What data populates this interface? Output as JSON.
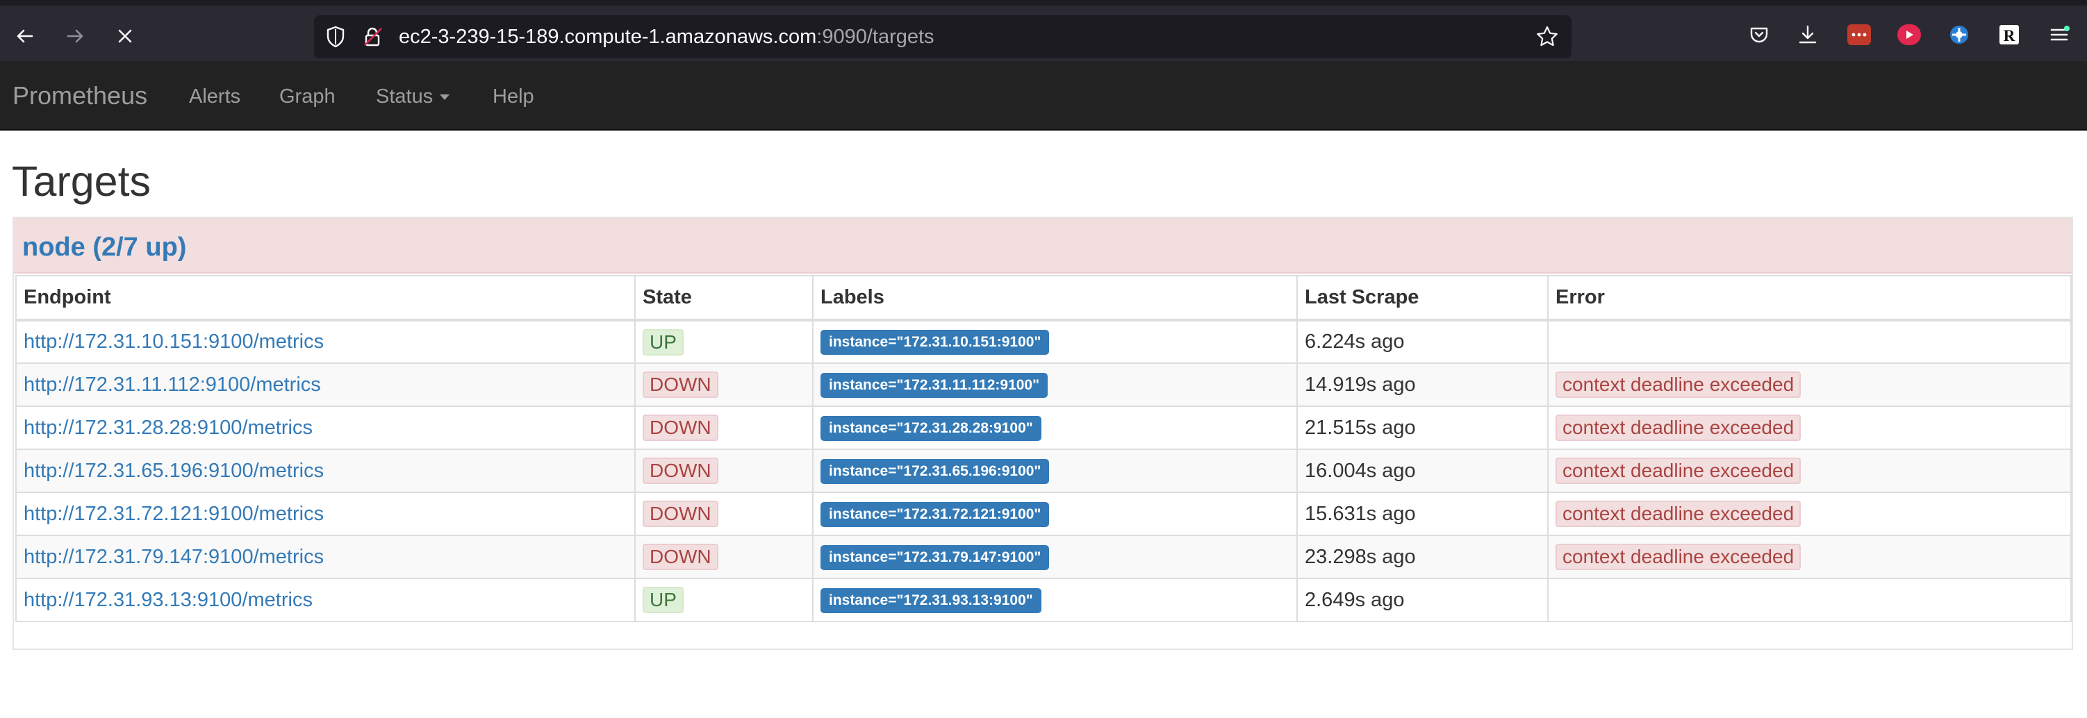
{
  "browser": {
    "url_host": "ec2-3-239-15-189.compute-1.amazonaws.com",
    "url_rest": ":9090/targets",
    "icons": [
      "back-icon",
      "forward-icon",
      "stop-icon",
      "shield-icon",
      "lock-icon",
      "bookmark-star-icon",
      "pocket-icon",
      "download-icon",
      "extension-icon",
      "extension-icon",
      "extension-icon",
      "readwise-icon",
      "menu-icon"
    ]
  },
  "navbar": {
    "brand": "Prometheus",
    "links": [
      "Alerts",
      "Graph",
      "Status",
      "Help"
    ]
  },
  "page": {
    "title": "Targets"
  },
  "job": {
    "heading": "node (2/7 up)",
    "columns": [
      "Endpoint",
      "State",
      "Labels",
      "Last Scrape",
      "Error"
    ],
    "rows": [
      {
        "endpoint": "http://172.31.10.151:9100/metrics",
        "state": "UP",
        "label": "instance=\"172.31.10.151:9100\"",
        "last_scrape": "6.224s ago",
        "error": ""
      },
      {
        "endpoint": "http://172.31.11.112:9100/metrics",
        "state": "DOWN",
        "label": "instance=\"172.31.11.112:9100\"",
        "last_scrape": "14.919s ago",
        "error": "context deadline exceeded"
      },
      {
        "endpoint": "http://172.31.28.28:9100/metrics",
        "state": "DOWN",
        "label": "instance=\"172.31.28.28:9100\"",
        "last_scrape": "21.515s ago",
        "error": "context deadline exceeded"
      },
      {
        "endpoint": "http://172.31.65.196:9100/metrics",
        "state": "DOWN",
        "label": "instance=\"172.31.65.196:9100\"",
        "last_scrape": "16.004s ago",
        "error": "context deadline exceeded"
      },
      {
        "endpoint": "http://172.31.72.121:9100/metrics",
        "state": "DOWN",
        "label": "instance=\"172.31.72.121:9100\"",
        "last_scrape": "15.631s ago",
        "error": "context deadline exceeded"
      },
      {
        "endpoint": "http://172.31.79.147:9100/metrics",
        "state": "DOWN",
        "label": "instance=\"172.31.79.147:9100\"",
        "last_scrape": "23.298s ago",
        "error": "context deadline exceeded"
      },
      {
        "endpoint": "http://172.31.93.13:9100/metrics",
        "state": "UP",
        "label": "instance=\"172.31.93.13:9100\"",
        "last_scrape": "2.649s ago",
        "error": ""
      }
    ]
  },
  "colors": {
    "link": "#337ab7",
    "up": "#3c763d",
    "down": "#a94442",
    "heading_bg": "#f2dede",
    "navbar_bg": "#222222"
  }
}
